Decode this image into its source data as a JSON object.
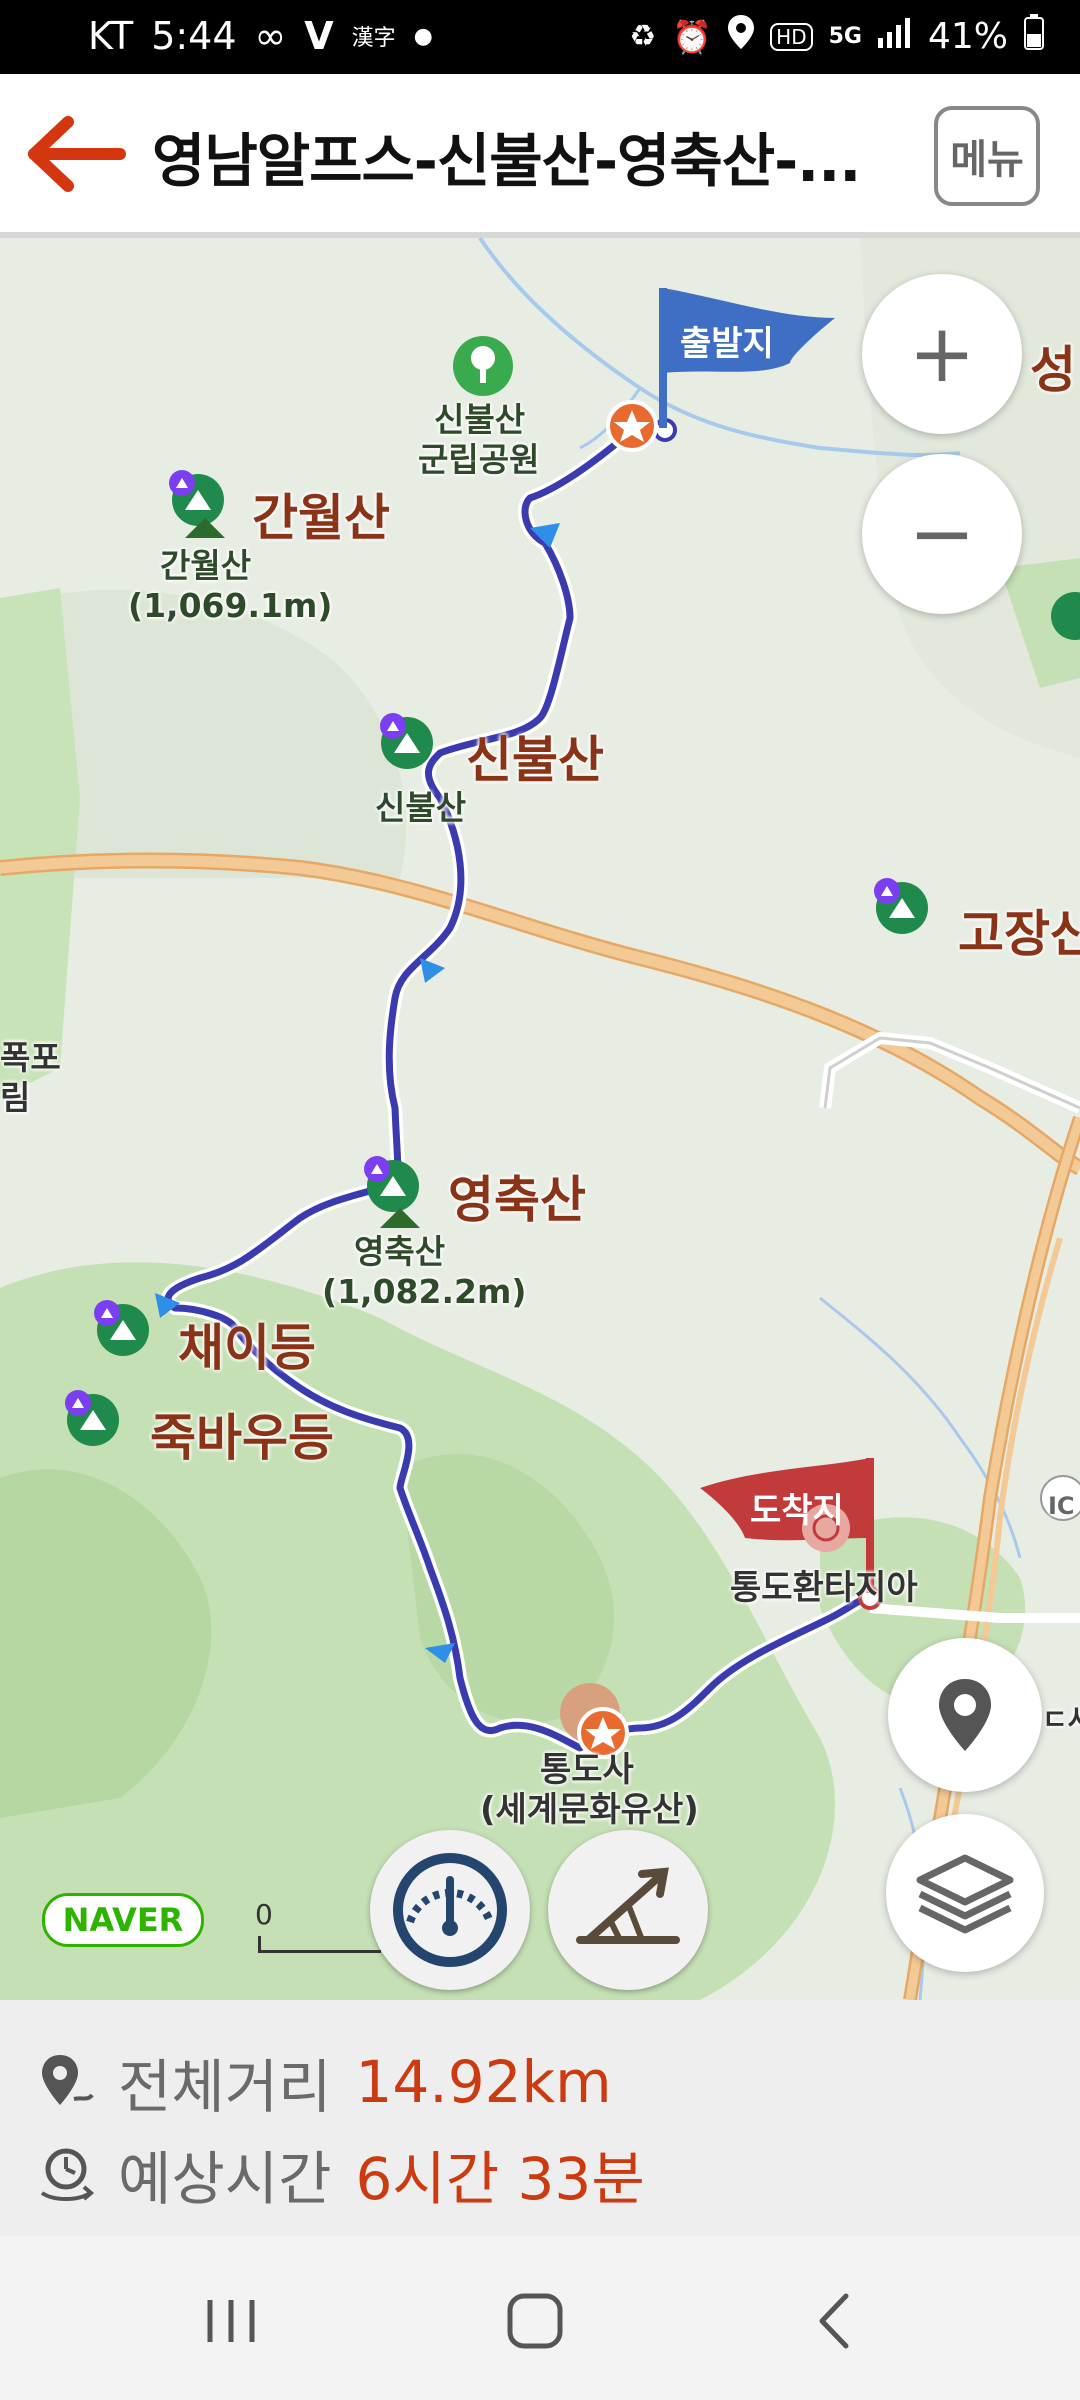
{
  "status_bar": {
    "carrier": "KT",
    "time": "5:44",
    "battery": "41%",
    "left_icons": [
      "infinity-icon",
      "v-icon",
      "hanja-icon",
      "dot-icon"
    ],
    "right_icons": [
      "battery-saver-icon",
      "alarm-icon",
      "location-icon",
      "hd-icon",
      "5g-icon",
      "signal-icon",
      "battery-icon"
    ]
  },
  "header": {
    "title": "영남알프스-신불산-영축산-...",
    "menu_label": "메뉴"
  },
  "map": {
    "start_flag": "출발지",
    "end_flag": "도착지",
    "labels": {
      "ganwolsan_big": "간월산",
      "ganwolsan_small": "간월산",
      "ganwolsan_height": "(1,069.1m)",
      "sinbulsan_big": "신불산",
      "sinbulsan_small": "신불산",
      "sinbulsan_park_1": "신불산",
      "sinbulsan_park_2": "군립공원",
      "yeongchuksan_big": "영축산",
      "yeongchuksan_small": "영축산",
      "yeongchuksan_height": "(1,082.2m)",
      "chaeideung": "채이등",
      "jukbaudeung": "죽바우등",
      "gojangsan": "고장산",
      "tongdo_fantasia": "통도환타지아",
      "tongdosa": "통도사",
      "tongdosa_sub": "(세계문화유산)",
      "edge_seong": "성",
      "edge_pokpo_1": "폭포",
      "edge_pokpo_2": "림",
      "edge_ic": "IC",
      "edge_right": "ㄷ사"
    },
    "naver_logo": "NAVER",
    "scale_text": "0",
    "controls": {
      "zoom_in": "+",
      "zoom_out": "−"
    }
  },
  "route_info": {
    "distance_label": "전체거리",
    "distance_value": "14.92km",
    "time_label": "예상시간",
    "time_value": "6시간 33분"
  },
  "colors": {
    "route": "#3b3bb0",
    "accent_red": "#cc3a10",
    "start_flag": "#3f6fc4",
    "end_flag": "#c23a3a"
  }
}
